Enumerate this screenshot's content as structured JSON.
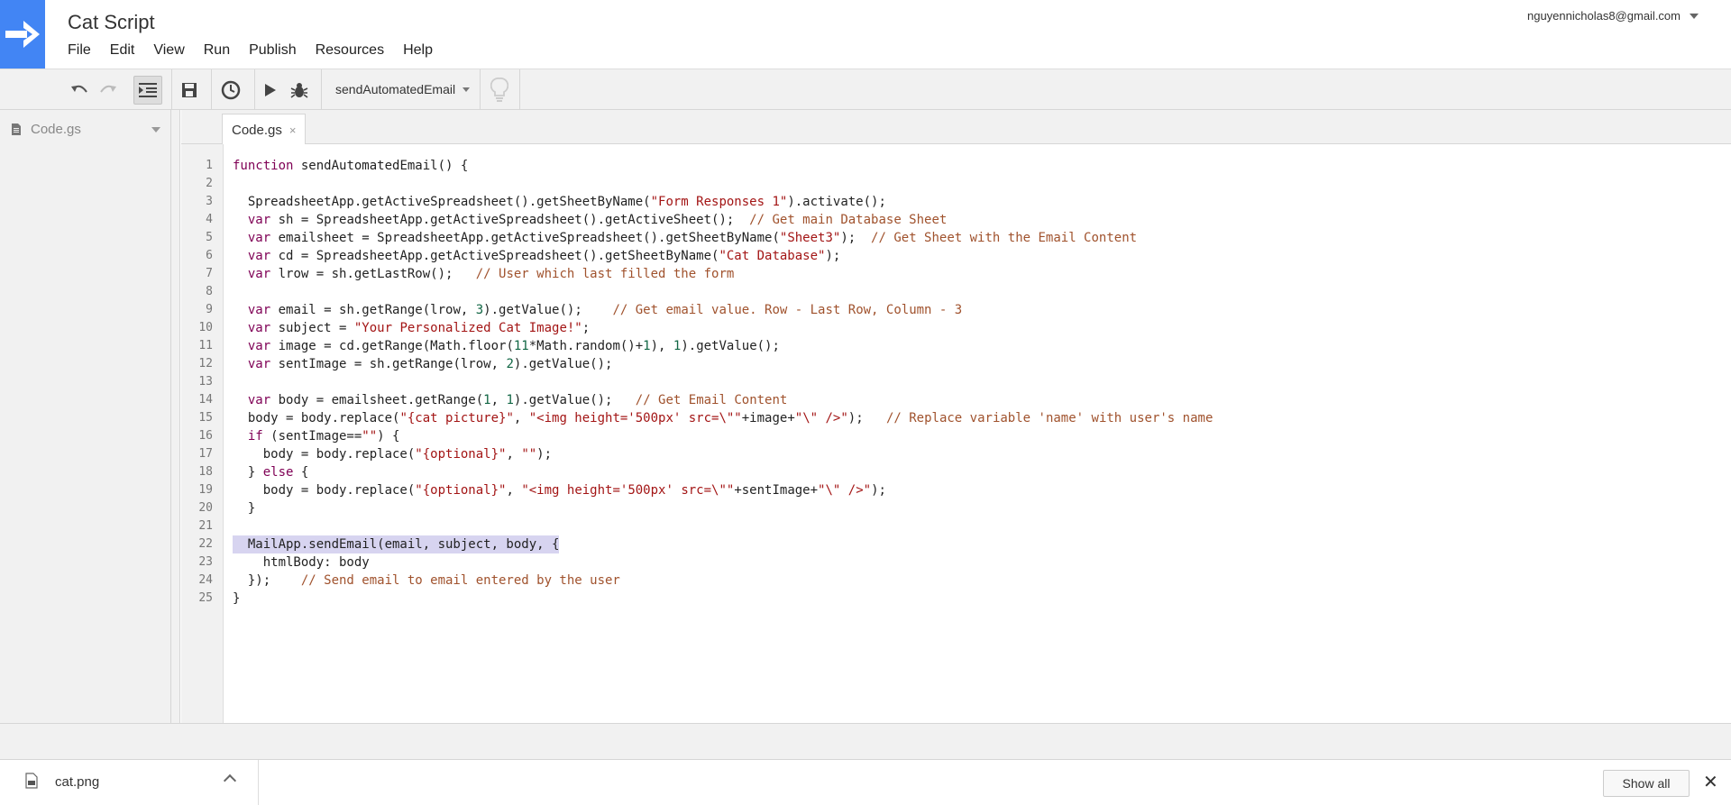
{
  "header": {
    "title": "Cat Script",
    "menu": [
      "File",
      "Edit",
      "View",
      "Run",
      "Publish",
      "Resources",
      "Help"
    ],
    "account": "nguyennicholas8@gmail.com"
  },
  "toolbar": {
    "function_name": "sendAutomatedEmail"
  },
  "sidebar": {
    "file": "Code.gs"
  },
  "tabs": [
    {
      "label": "Code.gs",
      "close": "×"
    }
  ],
  "editor": {
    "lines": [
      "function sendAutomatedEmail() {",
      "",
      "  SpreadsheetApp.getActiveSpreadsheet().getSheetByName(\"Form Responses 1\").activate();",
      "  var sh = SpreadsheetApp.getActiveSpreadsheet().getActiveSheet();  // Get main Database Sheet",
      "  var emailsheet = SpreadsheetApp.getActiveSpreadsheet().getSheetByName(\"Sheet3\");  // Get Sheet with the Email Content",
      "  var cd = SpreadsheetApp.getActiveSpreadsheet().getSheetByName(\"Cat Database\");",
      "  var lrow = sh.getLastRow();   // User which last filled the form",
      "",
      "  var email = sh.getRange(lrow, 3).getValue();    // Get email value. Row - Last Row, Column - 3",
      "  var subject = \"Your Personalized Cat Image!\";",
      "  var image = cd.getRange(Math.floor(11*Math.random()+1), 1).getValue();",
      "  var sentImage = sh.getRange(lrow, 2).getValue();",
      "",
      "  var body = emailsheet.getRange(1, 1).getValue();   // Get Email Content",
      "  body = body.replace(\"{cat picture}\", \"<img height='500px' src=\\\"\"+image+\"\\\" />\");   // Replace variable 'name' with user's name",
      "  if (sentImage==\"\") {",
      "    body = body.replace(\"{optional}\", \"\");",
      "  } else {",
      "    body = body.replace(\"{optional}\", \"<img height='500px' src=\\\"\"+sentImage+\"\\\" />\");",
      "  }",
      "",
      "  MailApp.sendEmail(email, subject, body, {",
      "    htmlBody: body",
      "  });    // Send email to email entered by the user",
      "}"
    ],
    "highlighted_line": 22
  },
  "downloads": {
    "file": "cat.png",
    "show_all": "Show all",
    "close": "✕"
  }
}
